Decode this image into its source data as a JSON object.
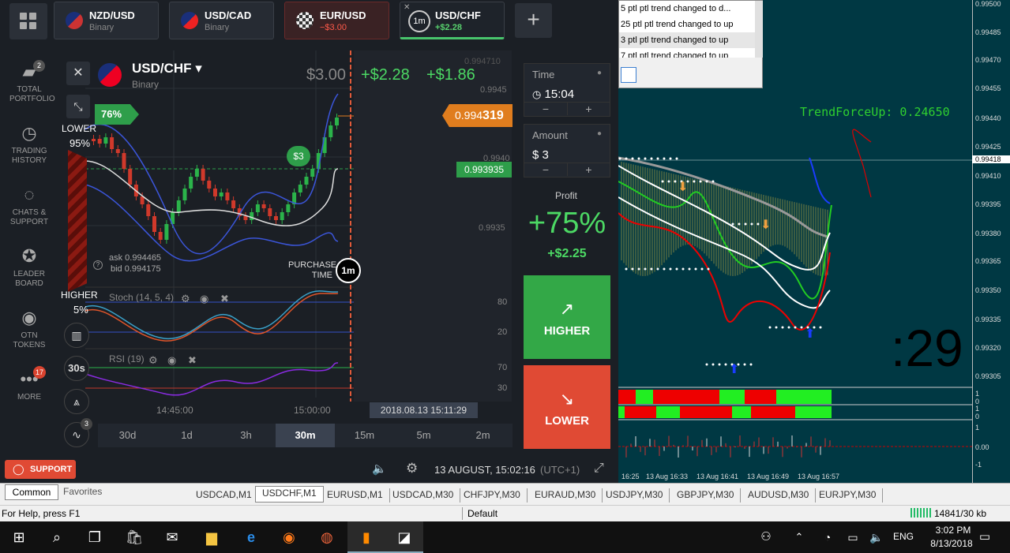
{
  "tabs": [
    {
      "pair": "NZD/USD",
      "sub": "Binary"
    },
    {
      "pair": "USD/CAD",
      "sub": "Binary"
    },
    {
      "pair": "EUR/USD",
      "sub": "−$3.00"
    },
    {
      "pair": "USD/CHF",
      "sub": "+$2.28",
      "badge": "1m"
    }
  ],
  "sidebar": [
    {
      "icon": "portfolio-icon",
      "label": "TOTAL PORTFOLIO",
      "badge": "2"
    },
    {
      "icon": "clock-history-icon",
      "label": "TRADING HISTORY"
    },
    {
      "icon": "chat-icon",
      "label": "CHATS & SUPPORT"
    },
    {
      "icon": "medal-icon",
      "label": "LEADER BOARD"
    },
    {
      "icon": "otn-icon",
      "label": "OTN TOKENS"
    },
    {
      "icon": "more-dots-icon",
      "label": "MORE",
      "badge": "17"
    }
  ],
  "asset": {
    "name": "USD/CHF ▾",
    "type": "Binary"
  },
  "header_values": {
    "invest": "$3.00",
    "gain1": "+$2.28",
    "gain2": "+$1.86"
  },
  "chart": {
    "lower_pct": "76%",
    "lower_label": "LOWER",
    "lower_share": "95%",
    "higher_label": "HIGHER",
    "higher_share": "5%",
    "price_tag_a": "0.994",
    "price_tag_b": "319",
    "entry_price": "0.993935",
    "dollar_badge": "$3",
    "y_ticks": [
      "0.994710",
      "0.9945",
      "0.9940",
      "0.9935"
    ],
    "ask": "ask 0.994465",
    "bid": "bid 0.994175",
    "purchase_time": "PURCHASE TIME",
    "purchase_badge": "1m",
    "stoch_label": "Stoch (14, 5, 4)",
    "stoch_levels": [
      "80",
      "20"
    ],
    "rsi_label": "RSI (19)",
    "rsi_levels": [
      "70",
      "30"
    ],
    "x_ticks": [
      "14:45:00",
      "15:00:00"
    ],
    "time_tag": "2018.08.13 15:11:29"
  },
  "tools": {
    "timeframe": "30s",
    "indicator_badge": "3"
  },
  "timeframes": [
    "30d",
    "1d",
    "3h",
    "30m",
    "15m",
    "5m",
    "2m"
  ],
  "timeframe_active": "30m",
  "panel": {
    "time_label": "Time",
    "time_value": "15:04",
    "amount_label": "Amount",
    "amount_value": "$ 3",
    "profit_label": "Profit",
    "profit_pct": "+75%",
    "profit_value": "+$2.25",
    "higher_btn": "HIGHER",
    "lower_btn": "LOWER"
  },
  "footer": {
    "support": "SUPPORT",
    "datetime": "13 AUGUST, 15:02:16",
    "tz": "(UTC+1)"
  },
  "mt4": {
    "log": [
      "5 ptl ptl trend changed to d...",
      "25 ptl ptl trend changed to up",
      "3 ptl ptl trend changed to up",
      "7 ptl ptl trend changed to up"
    ],
    "overlay_text": "TrendForceUp: 0.24650",
    "countdown": ":29",
    "price_axis": [
      "0.99500",
      "0.99485",
      "0.99470",
      "0.99455",
      "0.99440",
      "0.99425",
      "0.99418",
      "0.99410",
      "0.99395",
      "0.99380",
      "0.99365",
      "0.99350",
      "0.99335",
      "0.99320",
      "0.99305"
    ],
    "time_axis": [
      "16:25",
      "13 Aug 16:33",
      "13 Aug 16:41",
      "13 Aug 16:49",
      "13 Aug 16:57"
    ],
    "sub_axis": [
      "1",
      "0",
      "1",
      "0",
      "1",
      "0.00",
      "-1"
    ]
  },
  "bottom_tabs": {
    "left": [
      "Common",
      "Favorites"
    ],
    "charts": [
      "USDCAD,M1",
      "USDCHF,M1",
      "EURUSD,M1",
      "USDCAD,M30",
      "CHFJPY,M30",
      "EURAUD,M30",
      "USDJPY,M30",
      "GBPJPY,M30",
      "AUDUSD,M30",
      "EURJPY,M30"
    ],
    "active": "USDCHF,M1"
  },
  "status": {
    "help": "For Help, press F1",
    "profile": "Default",
    "traffic": "14841/30 kb"
  },
  "taskbar": {
    "lang": "ENG",
    "time": "3:02 PM",
    "date": "8/13/2018"
  }
}
